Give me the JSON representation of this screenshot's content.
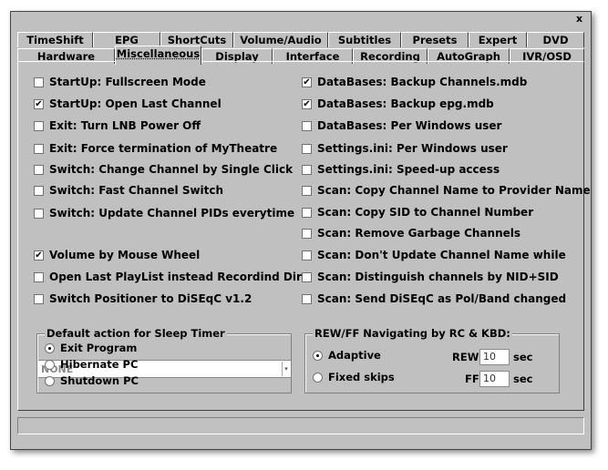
{
  "window": {
    "close_glyph": "x"
  },
  "tabs_row1": [
    "TimeShift",
    "EPG",
    "ShortCuts",
    "Volume/Audio",
    "Subtitles",
    "Presets",
    "Expert",
    "DVD"
  ],
  "tabs_row2": [
    "Hardware",
    "Miscellaneous",
    "Display",
    "Interface",
    "Recording",
    "AutoGraph",
    "IVR/OSD"
  ],
  "active_tab": "Miscellaneous",
  "options_left": [
    {
      "label": "StartUp: Fullscreen Mode",
      "checked": false
    },
    {
      "label": "StartUp: Open Last Channel",
      "checked": true
    },
    {
      "label": "Exit: Turn LNB Power Off",
      "checked": false
    },
    {
      "label": "Exit: Force termination of MyTheatre",
      "checked": false
    },
    {
      "label": "Switch: Change Channel by Single Click",
      "checked": false
    },
    {
      "label": "Switch: Fast Channel Switch",
      "checked": false
    },
    {
      "label": "Switch: Update Channel PIDs everytime",
      "checked": false
    },
    {
      "label": "Volume by Mouse Wheel",
      "checked": true
    },
    {
      "label": "Open Last PlayList instead Recordind Dir",
      "checked": false
    },
    {
      "label": "Switch Positioner to DiSEqC v1.2",
      "checked": false
    }
  ],
  "options_right": [
    {
      "label": "DataBases: Backup Channels.mdb",
      "checked": true
    },
    {
      "label": "DataBases: Backup epg.mdb",
      "checked": true
    },
    {
      "label": "DataBases: Per Windows user",
      "checked": false
    },
    {
      "label": "Settings.ini: Per Windows user",
      "checked": false
    },
    {
      "label": "Settings.ini: Speed-up access",
      "checked": false
    },
    {
      "label": "Scan: Copy Channel Name to Provider Name",
      "checked": false
    },
    {
      "label": "Scan: Copy SID to Channel Number",
      "checked": false
    },
    {
      "label": "Scan: Remove Garbage Channels",
      "checked": false
    },
    {
      "label": "Scan: Don't Update Channel Name while",
      "checked": false
    },
    {
      "label": "Scan: Distinguish channels by NID+SID",
      "checked": false
    },
    {
      "label": "Scan: Send DiSEqC as Pol/Band changed",
      "checked": false
    }
  ],
  "combo": {
    "value": "NONE",
    "arrow_glyph": "▾"
  },
  "sleep_group": {
    "title": "Default action for Sleep Timer",
    "options": [
      {
        "label": "Exit Program",
        "selected": true
      },
      {
        "label": "Hibernate PC",
        "selected": false
      },
      {
        "label": "Shutdown PC",
        "selected": false
      }
    ]
  },
  "rewff_group": {
    "title": "REW/FF Navigating by RC & KBD:",
    "options": [
      {
        "label": "Adaptive",
        "selected": true
      },
      {
        "label": "Fixed skips",
        "selected": false
      }
    ],
    "rew_label": "REW",
    "rew_value": "10",
    "ff_label": "FF",
    "ff_value": "10",
    "unit": "sec"
  },
  "checkmark_glyph": "✔"
}
